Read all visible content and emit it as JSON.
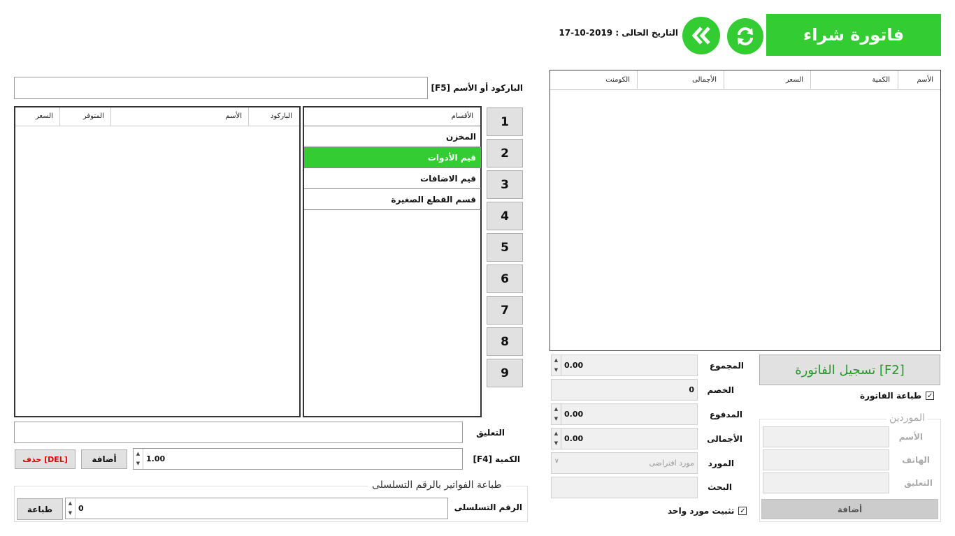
{
  "header": {
    "title": "فاتورة شراء",
    "date_text": "التاريخ الحالى : 2019-10-17"
  },
  "search": {
    "label": "الباركود أو الأسم [F5]",
    "value": ""
  },
  "products_table": {
    "columns": [
      "الباركود",
      "الأسم",
      "المتوفر",
      "السعر"
    ]
  },
  "categories": {
    "header": "الأقسام",
    "items": [
      "المخزن",
      "قيم الأدوات",
      "قيم الاضافات",
      "قسم القطع الصغيرة"
    ],
    "selected_index": 1
  },
  "numpad": [
    "1",
    "2",
    "3",
    "4",
    "5",
    "6",
    "7",
    "8",
    "9"
  ],
  "invoice_table": {
    "columns": [
      "الأسم",
      "الكمية",
      "السعر",
      "الأجمالى",
      "الكومنت"
    ]
  },
  "comment": {
    "label": "التعليق",
    "value": ""
  },
  "quantity": {
    "label": "الكمية [F4]",
    "value": "1.00"
  },
  "buttons": {
    "add": "أضافة",
    "delete": "حذف [DEL]",
    "print": "طباعة",
    "register": "تسجيل الفاتورة [F2]",
    "supplier_add": "أضافة"
  },
  "serial_print": {
    "legend": "طباعة الفواتير بالرقم التسلسلى",
    "label": "الرقم التسلسلى",
    "value": "0"
  },
  "totals": {
    "sum_label": "المجموع",
    "sum_value": "0.00",
    "discount_label": "الخصم",
    "discount_value": "0",
    "paid_label": "المدفوع",
    "paid_value": "0.00",
    "total_label": "الأجمالى",
    "total_value": "0.00",
    "supplier_label": "المورد",
    "supplier_value": "مورد افتراضى",
    "search_label": "البحث"
  },
  "checkboxes": {
    "print_invoice": "طباعة الفاتورة",
    "fix_supplier": "تثبيت مورد واحد"
  },
  "suppliers": {
    "legend": "الموردين",
    "name_label": "الأسم",
    "phone_label": "الهاتف",
    "comment_label": "التعليق"
  },
  "colors": {
    "accent": "#33cc33",
    "delete_text": "#e00000",
    "register_text": "#229922"
  }
}
